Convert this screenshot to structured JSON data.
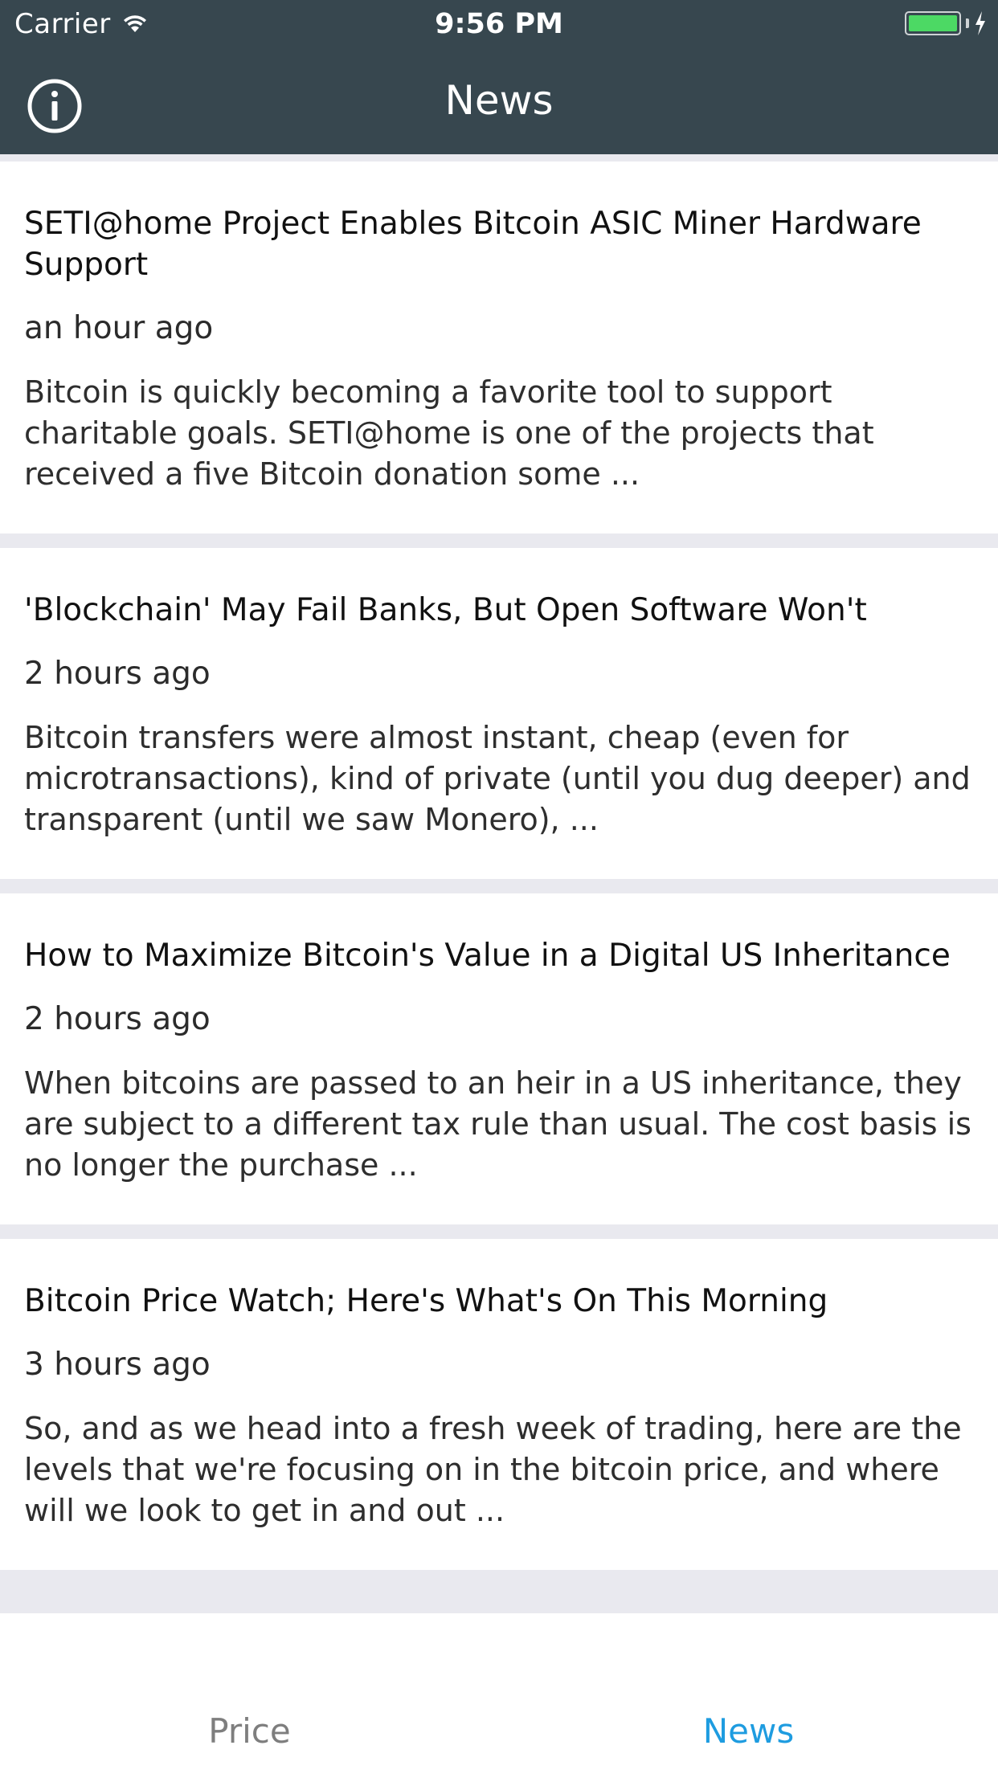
{
  "status_bar": {
    "carrier": "Carrier",
    "time": "9:56 PM",
    "battery_level": 1.0
  },
  "header": {
    "title": "News",
    "info_icon": "info-circle-icon"
  },
  "articles": [
    {
      "title": "SETI@home Project Enables Bitcoin ASIC Miner Hardware Support",
      "time": "an hour ago",
      "summary": "Bitcoin is quickly becoming a favorite tool to support charitable goals. SETI@home is one of the projects that received a five Bitcoin donation some ..."
    },
    {
      "title": "'Blockchain' May Fail Banks, But Open Software Won't",
      "time": "2 hours ago",
      "summary": "Bitcoin transfers were almost instant, cheap (even for microtransactions), kind of private (until you dug deeper) and transparent (until we saw Monero), ..."
    },
    {
      "title": "How to Maximize Bitcoin's Value in a Digital US Inheritance",
      "time": "2 hours ago",
      "summary": "When bitcoins are passed to an heir in a US inheritance, they are subject to a different tax rule than usual. The cost basis is no longer the purchase ..."
    },
    {
      "title": "Bitcoin Price Watch; Here's What's On This Morning",
      "time": "3 hours ago",
      "summary": "So, and as we head into a fresh week of trading, here are the levels that we're focusing on in the bitcoin price, and where will we look to get in and out ..."
    }
  ],
  "tabs": {
    "price_label": "Price",
    "news_label": "News",
    "active_color": "#1e9ce0",
    "inactive_color": "#7e7e7e"
  },
  "colors": {
    "nav_background": "#37474f",
    "feed_background": "#e9e9ef",
    "battery": "#4cd964"
  }
}
